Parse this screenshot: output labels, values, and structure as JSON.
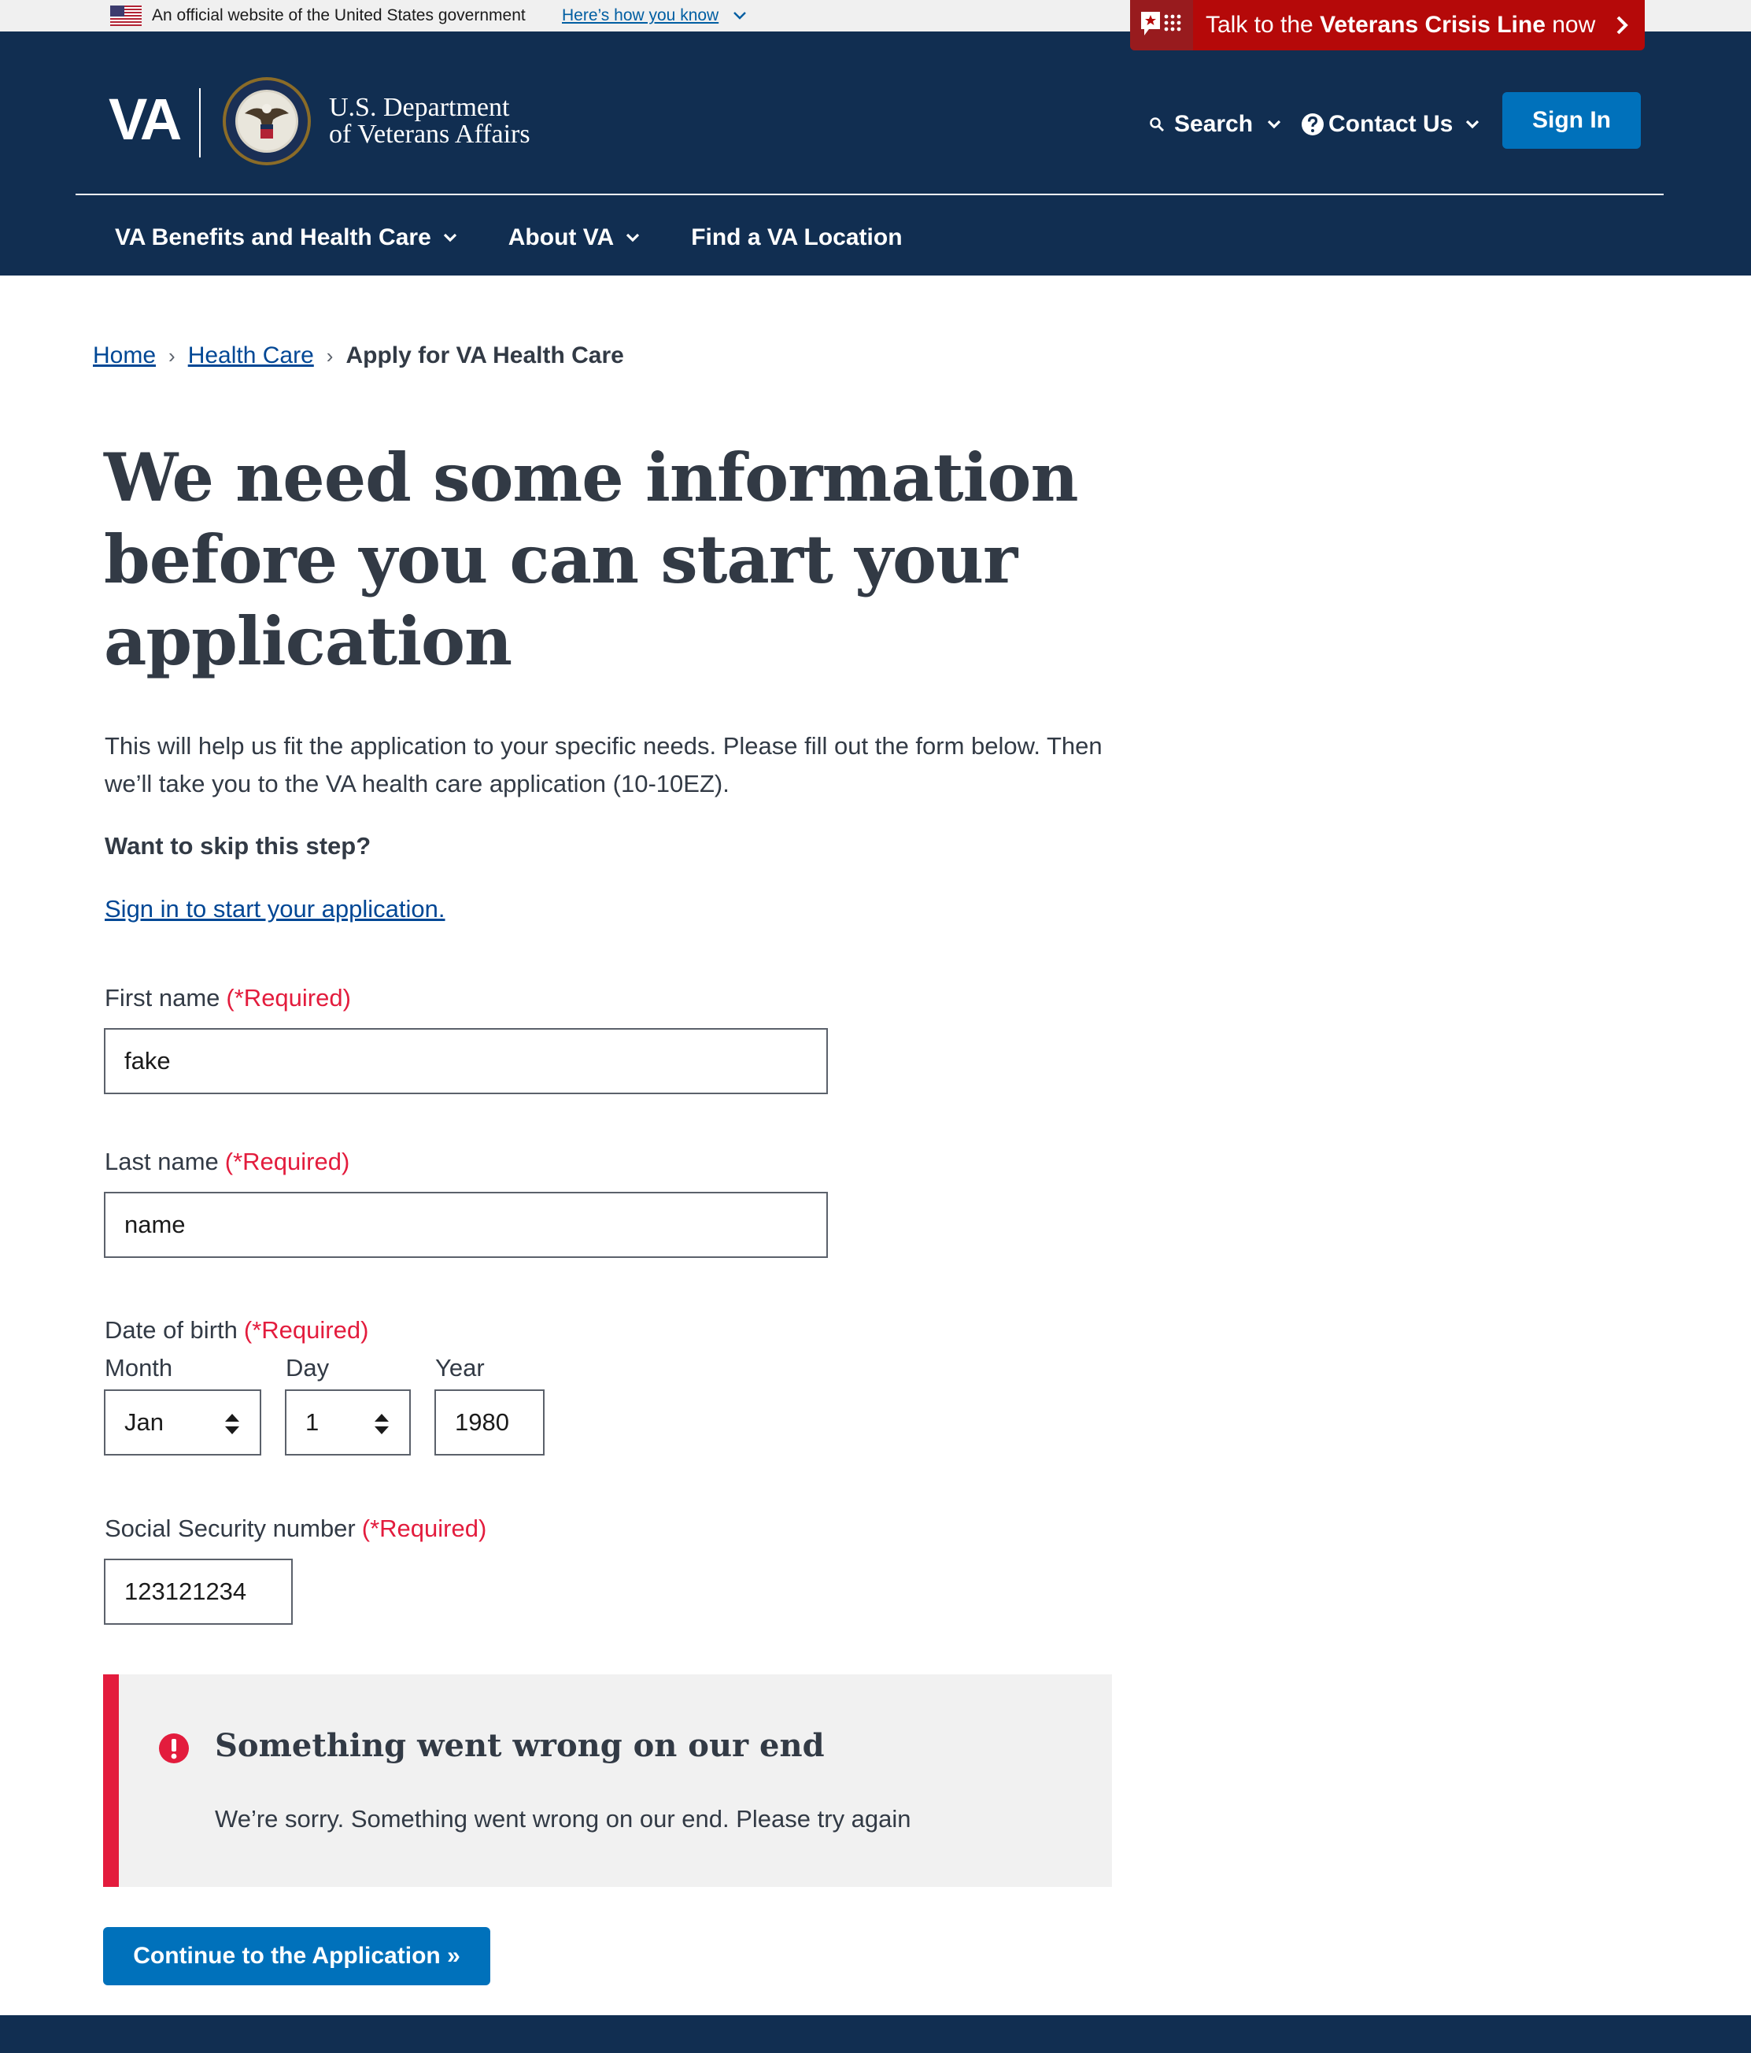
{
  "gov_banner": {
    "official_text": "An official website of the United States government",
    "how_link": "Here’s how you know"
  },
  "crisis_line": {
    "prefix": "Talk to the ",
    "emphasis": "Veterans Crisis Line",
    "suffix": " now"
  },
  "header": {
    "wordmark": "VA",
    "dept_line1": "U.S. Department",
    "dept_line2": "of Veterans Affairs",
    "search_label": "Search",
    "contact_label": "Contact Us",
    "signin_label": "Sign In",
    "nav": [
      {
        "label": "VA Benefits and Health Care"
      },
      {
        "label": "About VA"
      },
      {
        "label": "Find a VA Location"
      }
    ]
  },
  "breadcrumb": {
    "items": [
      "Home",
      "Health Care"
    ],
    "current": "Apply for VA Health Care",
    "separator": "›"
  },
  "main": {
    "title": "We need some information before you can start your application",
    "intro": "This will help us fit the application to your specific needs. Please fill out the form below. Then we’ll take you to the VA health care application (10-10EZ).",
    "skip_question": "Want to skip this step?",
    "signin_link": "Sign in to start your application."
  },
  "form": {
    "required_marker": "(*Required)",
    "first_name": {
      "label": "First name",
      "value": "fake"
    },
    "last_name": {
      "label": "Last name",
      "value": "name"
    },
    "dob": {
      "label": "Date of birth",
      "month_label": "Month",
      "month_value": "Jan",
      "day_label": "Day",
      "day_value": "1",
      "year_label": "Year",
      "year_value": "1980"
    },
    "ssn": {
      "label": "Social Security number",
      "value": "123121234"
    }
  },
  "alert": {
    "heading": "Something went wrong on our end",
    "body": "We’re sorry. Something went wrong on our end. Please try again"
  },
  "continue_label": "Continue to the Application »",
  "colors": {
    "header_navy": "#112e51",
    "primary_blue": "#0071bb",
    "crisis_red": "#b50909",
    "error_red": "#e31c3d",
    "link_blue": "#004795"
  },
  "icons": [
    "us-flag-icon",
    "chevron-down-icon",
    "search-icon",
    "question-circle-icon",
    "crisis-chat-icon",
    "chevron-right-icon",
    "va-seal-icon",
    "error-icon",
    "select-updown-icon"
  ]
}
